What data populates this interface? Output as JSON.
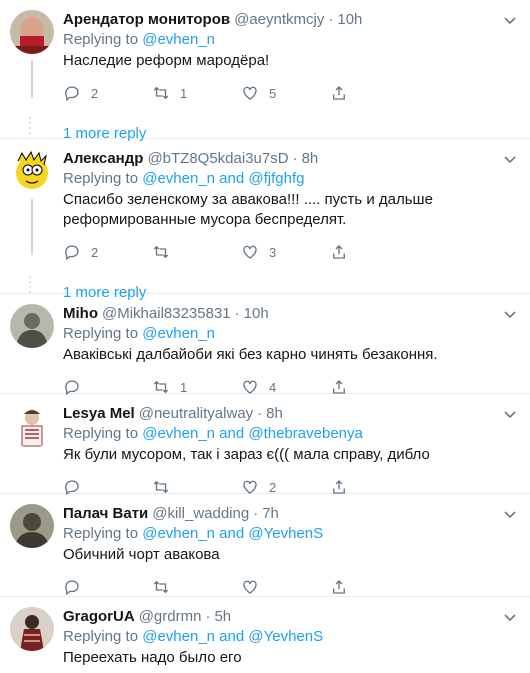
{
  "tweets": [
    {
      "name": "Арендатор мониторов",
      "handle": "@aeyntkmcjy",
      "time": "10h",
      "replying_prefix": "Replying to ",
      "replying_to": "@evhen_n",
      "replying_and": "",
      "replying_to2": "",
      "text": "Наследие реформ мародёра!",
      "replies": "2",
      "retweets": "1",
      "likes": "5",
      "more_reply": "1 more reply"
    },
    {
      "name": "Александр",
      "handle": "@bTZ8Q5kdai3u7sD",
      "time": "8h",
      "replying_prefix": "Replying to ",
      "replying_to": "@evhen_n",
      "replying_and": " and ",
      "replying_to2": "@fjfghfg",
      "text": "Спасибо зеленскому за авакова!!!  .... пусть и дальше реформированные мусора беспределят.",
      "replies": "2",
      "retweets": "",
      "likes": "3",
      "more_reply": "1 more reply"
    },
    {
      "name": "Miho",
      "handle": "@Mikhail83235831",
      "time": "10h",
      "replying_prefix": "Replying to ",
      "replying_to": "@evhen_n",
      "replying_and": "",
      "replying_to2": "",
      "text": "Аваківські далбайоби які без карно чинять безаконня.",
      "replies": "",
      "retweets": "1",
      "likes": "4"
    },
    {
      "name": "Lesya Mel",
      "handle": "@neutralityalway",
      "time": "8h",
      "replying_prefix": "Replying to ",
      "replying_to": "@evhen_n",
      "replying_and": " and ",
      "replying_to2": "@thebravebenya",
      "text": "Як були мусором, так і зараз є((( мала справу, дибло",
      "replies": "",
      "retweets": "",
      "likes": "2"
    },
    {
      "name": "Палач Вати",
      "handle": "@kill_wadding",
      "time": "7h",
      "replying_prefix": "Replying to ",
      "replying_to": "@evhen_n",
      "replying_and": " and ",
      "replying_to2": "@YevhenS",
      "text": "Обичний чорт авакова",
      "replies": "",
      "retweets": "",
      "likes": ""
    },
    {
      "name": "GragorUA",
      "handle": "@grdrmn",
      "time": "5h",
      "replying_prefix": "Replying to ",
      "replying_to": "@evhen_n",
      "replying_and": " and ",
      "replying_to2": "@YevhenS",
      "text": "Переехать надо было его"
    }
  ],
  "colors": {
    "accent": "#1da1f2",
    "muted": "#657786",
    "border": "#e6ecf0"
  },
  "icons": [
    "reply-icon",
    "retweet-icon",
    "like-icon",
    "share-icon",
    "chevron-down-icon"
  ]
}
